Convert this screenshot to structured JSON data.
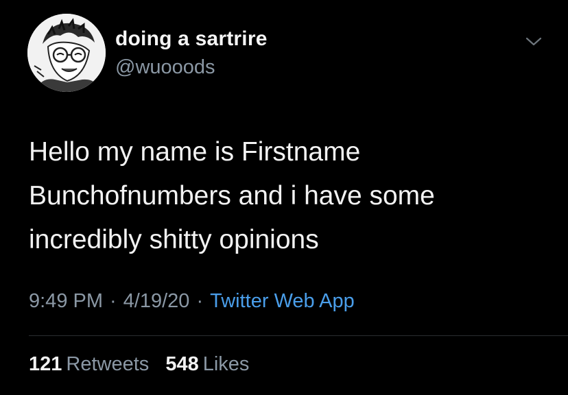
{
  "author": {
    "display_name": "doing a sartrire",
    "handle": "@wuooods",
    "avatar_icon": "avatar-illustration"
  },
  "tweet": {
    "text_lines": [
      "Hello my name is Firstname",
      "Bunchofnumbers and i have some",
      "incredibly shitty opinions"
    ],
    "time": "9:49 PM",
    "date": "4/19/20",
    "separator": "·",
    "source": "Twitter Web App"
  },
  "stats": {
    "retweets_count": "121",
    "retweets_label": "Retweets",
    "likes_count": "548",
    "likes_label": "Likes"
  },
  "icons": {
    "menu": "chevron-down-icon"
  },
  "colors": {
    "background": "#000000",
    "text": "#f2f2f2",
    "secondary": "#8b98a5",
    "link": "#4a9eea"
  }
}
